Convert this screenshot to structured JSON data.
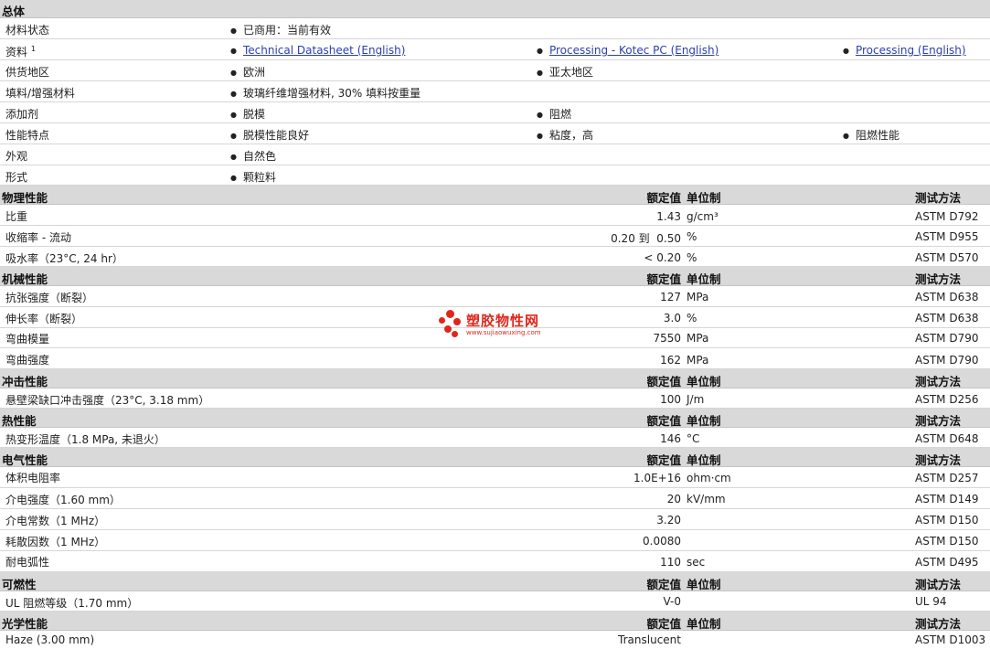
{
  "general": {
    "title": "总体",
    "rows": [
      {
        "label": "材料状态",
        "items": [
          "已商用：当前有效"
        ]
      },
      {
        "label": "资料",
        "sup": "1",
        "links": [
          "Technical Datasheet (English)",
          "Processing - Kotec PC (English)",
          "Processing (English)"
        ]
      },
      {
        "label": "供货地区",
        "items": [
          "欧洲",
          "亚太地区"
        ]
      },
      {
        "label": "填料/增强材料",
        "items": [
          "玻璃纤维增强材料, 30% 填料按重量"
        ]
      },
      {
        "label": "添加剂",
        "items": [
          "脱模",
          "阻燃"
        ]
      },
      {
        "label": "性能特点",
        "items": [
          "脱模性能良好",
          "粘度，高",
          "阻燃性能"
        ]
      },
      {
        "label": "外观",
        "items": [
          "自然色"
        ]
      },
      {
        "label": "形式",
        "items": [
          "颗粒料"
        ]
      }
    ]
  },
  "columns": {
    "value": "额定值",
    "unit": "单位制",
    "method": "测试方法"
  },
  "sections": [
    {
      "title": "物理性能",
      "rows": [
        {
          "label": "比重",
          "value": "1.43",
          "unit": "g/cm³",
          "method": "ASTM D792"
        },
        {
          "label": "收缩率 - 流动",
          "value": "0.20 到  0.50",
          "unit": "%",
          "method": "ASTM D955"
        },
        {
          "label": "吸水率（23°C, 24 hr）",
          "value": "< 0.20",
          "unit": "%",
          "method": "ASTM D570"
        }
      ]
    },
    {
      "title": "机械性能",
      "rows": [
        {
          "label": "抗张强度（断裂）",
          "value": "127",
          "unit": "MPa",
          "method": "ASTM D638"
        },
        {
          "label": "伸长率（断裂）",
          "value": "3.0",
          "unit": "%",
          "method": "ASTM D638"
        },
        {
          "label": "弯曲模量",
          "value": "7550",
          "unit": "MPa",
          "method": "ASTM D790"
        },
        {
          "label": "弯曲强度",
          "value": "162",
          "unit": "MPa",
          "method": "ASTM D790"
        }
      ]
    },
    {
      "title": "冲击性能",
      "rows": [
        {
          "label": "悬壁梁缺口冲击强度（23°C, 3.18 mm）",
          "value": "100",
          "unit": "J/m",
          "method": "ASTM D256"
        }
      ]
    },
    {
      "title": "热性能",
      "rows": [
        {
          "label": "热变形温度（1.8 MPa, 未退火）",
          "value": "146",
          "unit": "°C",
          "method": "ASTM D648"
        }
      ]
    },
    {
      "title": "电气性能",
      "rows": [
        {
          "label": "体积电阻率",
          "value": "1.0E+16",
          "unit": "ohm·cm",
          "method": "ASTM D257"
        },
        {
          "label": "介电强度（1.60 mm）",
          "value": "20",
          "unit": "kV/mm",
          "method": "ASTM D149"
        },
        {
          "label": "介电常数（1 MHz）",
          "value": "3.20",
          "unit": "",
          "method": "ASTM D150"
        },
        {
          "label": "耗散因数（1 MHz）",
          "value": "0.0080",
          "unit": "",
          "method": "ASTM D150"
        },
        {
          "label": "耐电弧性",
          "value": "110",
          "unit": "sec",
          "method": "ASTM D495"
        }
      ]
    },
    {
      "title": "可燃性",
      "rows": [
        {
          "label": "UL 阻燃等级（1.70 mm）",
          "value": "V-0",
          "unit": "",
          "method": "UL 94"
        }
      ]
    },
    {
      "title": "光学性能",
      "rows": [
        {
          "label": "Haze (3.00 mm)",
          "value": "Translucent",
          "unit": "",
          "method": "ASTM D1003"
        }
      ]
    }
  ],
  "watermark": {
    "text": "塑胶物性网",
    "url": "www.sujiaowuxing.com"
  }
}
